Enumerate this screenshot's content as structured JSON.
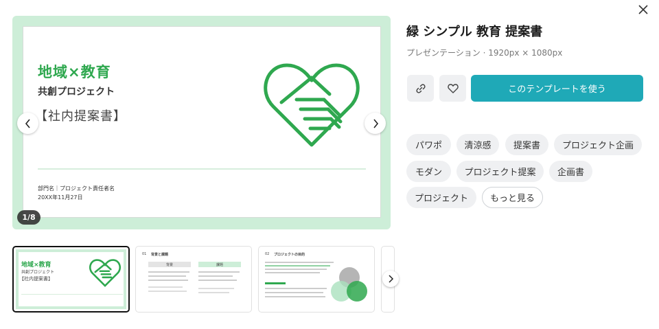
{
  "preview": {
    "slide": {
      "title": "地域×教育",
      "subtitle": "共創プロジェクト",
      "tag": "【社内提案書】",
      "department": "部門名｜プロジェクト責任者名",
      "date": "20XX年11月27日"
    },
    "page_counter": "1/8",
    "accent_color": "#2fa84f"
  },
  "thumbnails": [
    {
      "title": "地域×教育",
      "subtitle": "共創プロジェクト",
      "tag": "【社内提案書】"
    },
    {
      "number": "01",
      "heading": "背景と課題",
      "col_left": "背景",
      "col_right": "課題"
    },
    {
      "number": "02",
      "heading": "プロジェクトの目的"
    }
  ],
  "template": {
    "title": "緑 シンプル 教育 提案書",
    "meta": "プレゼンテーション · 1920px × 1080px",
    "use_button": "このテンプレートを使う"
  },
  "tags": [
    "パワポ",
    "清涼感",
    "提案書",
    "プロジェクト企画",
    "モダン",
    "プロジェクト提案",
    "企画書",
    "プロジェクト"
  ],
  "more_label": "もっと見る"
}
